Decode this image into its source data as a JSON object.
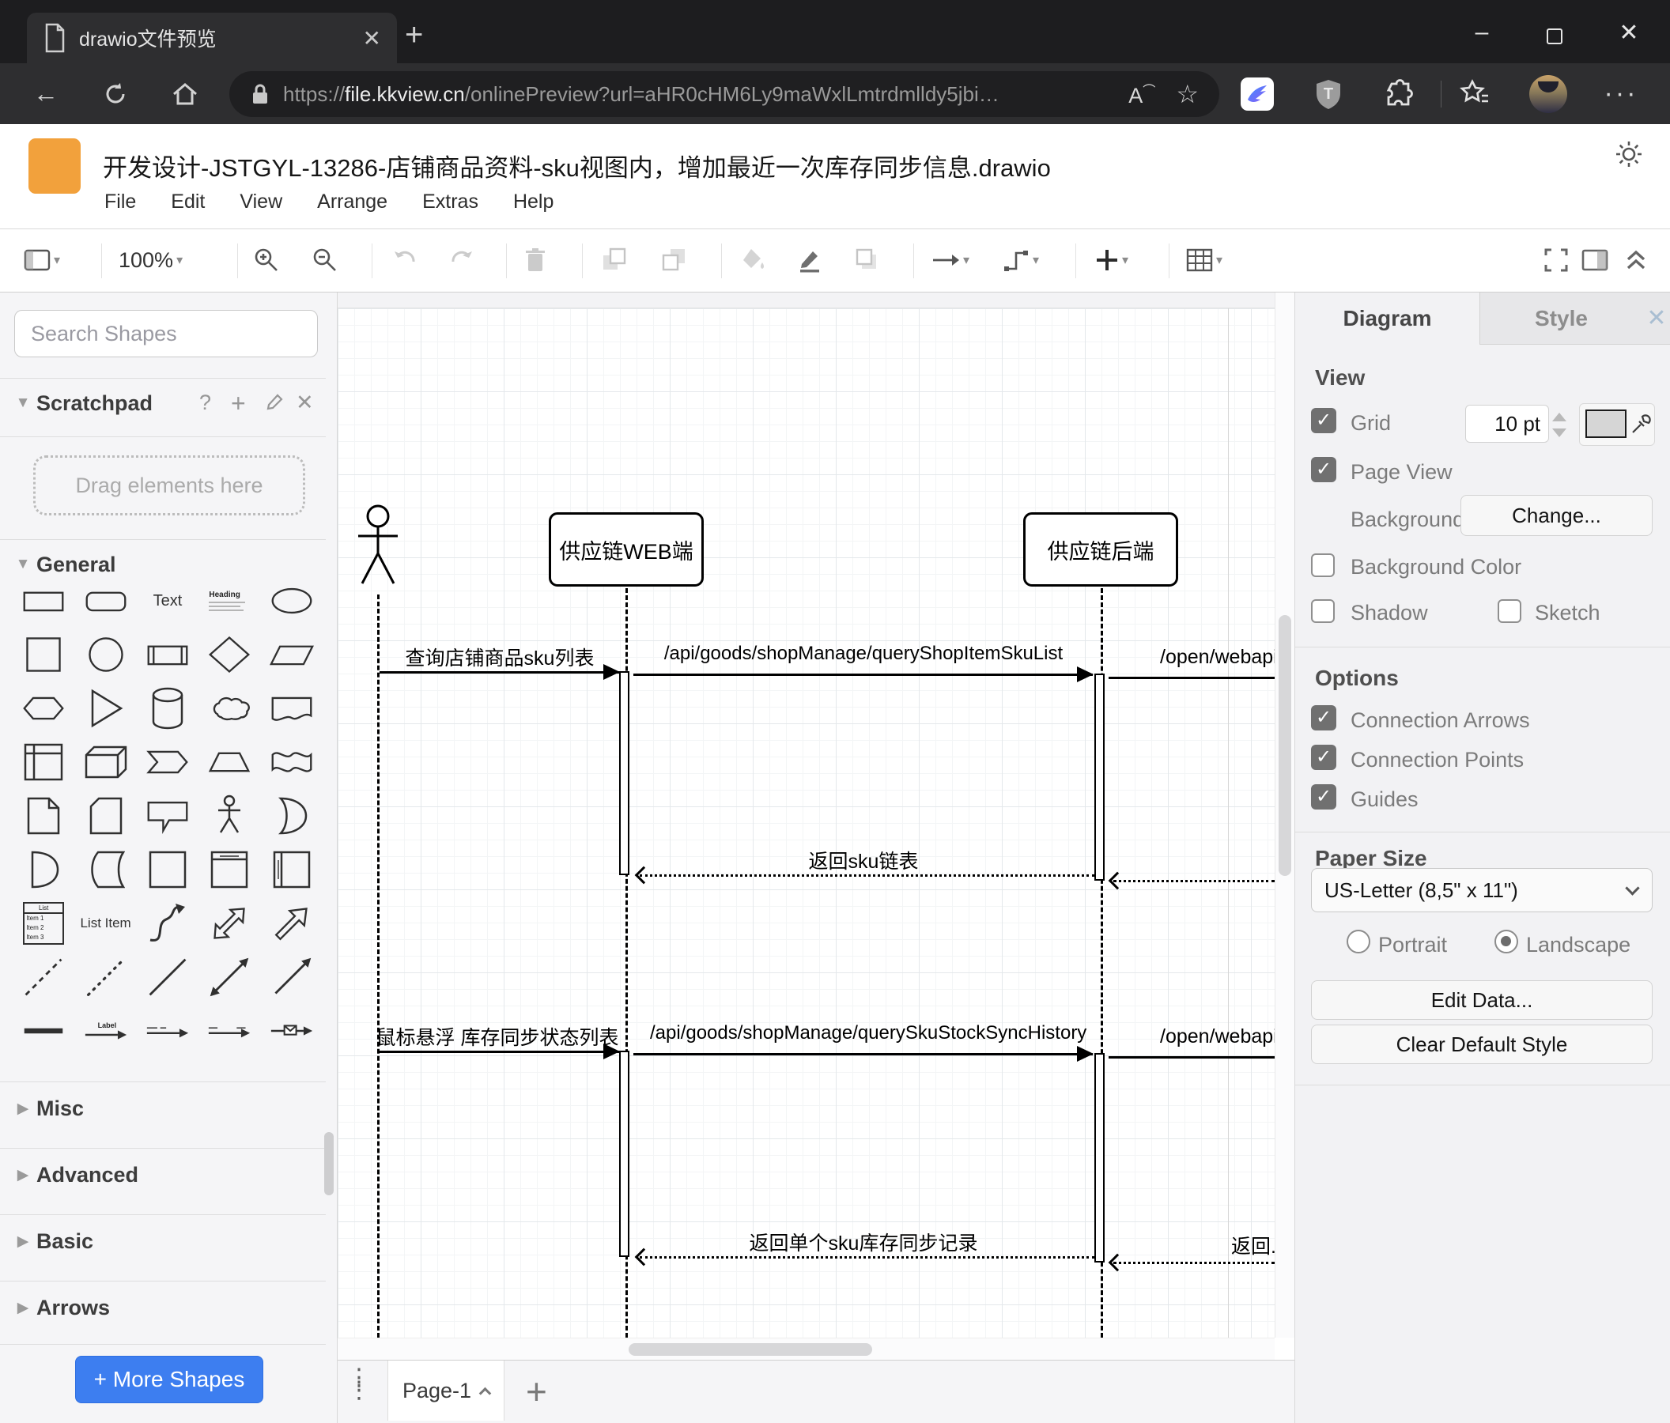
{
  "browser": {
    "tab_title": "drawio文件预览",
    "url_scheme": "https://",
    "url_host": "file.kkview.cn",
    "url_rest": "/onlinePreview?url=aHR0cHM6Ly9maWxlLmtrdmlldy5jbi…"
  },
  "app": {
    "title": "开发设计-JSTGYL-13286-店铺商品资料-sku视图内，增加最近一次库存同步信息.drawio",
    "menus": [
      "File",
      "Edit",
      "View",
      "Arrange",
      "Extras",
      "Help"
    ],
    "zoom_level": "100%"
  },
  "sidebar": {
    "search_placeholder": "Search Shapes",
    "scratchpad_title": "Scratchpad",
    "scratchpad_help": "?",
    "drag_hint": "Drag elements here",
    "section_general": "General",
    "section_misc": "Misc",
    "section_advanced": "Advanced",
    "section_basic": "Basic",
    "section_arrows": "Arrows",
    "more_shapes": "+ More Shapes",
    "shapes": {
      "text": "Text",
      "heading": "Heading",
      "list": "List",
      "list_item1": "Item 1",
      "list_item2": "Item 2",
      "list_item3": "Item 3",
      "list_item_label": "List Item",
      "label": "Label"
    }
  },
  "canvas": {
    "web_lifeline": "供应链WEB端",
    "backend_lifeline": "供应链后端",
    "messages": {
      "m1": "查询店铺商品sku列表",
      "m2": "/api/goods/shopManage/queryShopItemSkuList",
      "m3": "/open/webapi/",
      "m4": "返回sku链表",
      "m6": "鼠标悬浮 库存同步状态列表",
      "m7": "/api/goods/shopManage/querySkuStockSyncHistory",
      "m8": "/open/webapi/item",
      "m9": "返回单个sku库存同步记录",
      "m10": "返回..."
    }
  },
  "panel": {
    "tab_diagram": "Diagram",
    "tab_style": "Style",
    "view": {
      "heading": "View",
      "grid": "Grid",
      "grid_size": "10 pt",
      "page_view": "Page View",
      "background": "Background",
      "change": "Change...",
      "background_color": "Background Color",
      "shadow": "Shadow",
      "sketch": "Sketch"
    },
    "options": {
      "heading": "Options",
      "connection_arrows": "Connection Arrows",
      "connection_points": "Connection Points",
      "guides": "Guides"
    },
    "paper": {
      "heading": "Paper Size",
      "size": "US-Letter (8,5\" x 11\")",
      "portrait": "Portrait",
      "landscape": "Landscape"
    },
    "edit_data": "Edit Data...",
    "clear_default_style": "Clear Default Style"
  },
  "footer": {
    "page_tab": "Page-1"
  }
}
